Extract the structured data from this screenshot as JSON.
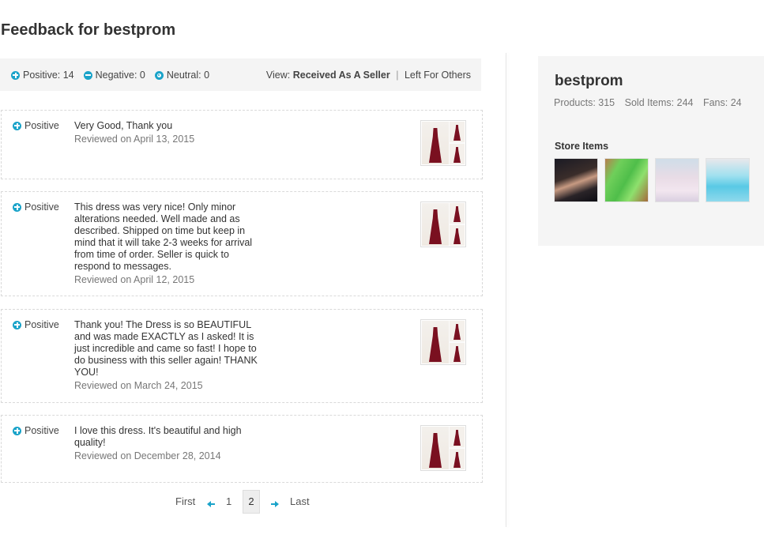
{
  "page": {
    "title": "Feedback for bestprom"
  },
  "summary": {
    "positive_label": "Positive: 14",
    "negative_label": "Negative: 0",
    "neutral_label": "Neutral: 0",
    "view_prefix": "View:",
    "view_selected": "Received As A Seller",
    "view_other": "Left For Others",
    "separator": "|"
  },
  "reviews": [
    {
      "rating": "Positive",
      "text": "Very Good, Thank you",
      "date": "Reviewed on April 13, 2015"
    },
    {
      "rating": "Positive",
      "text": "This dress was very nice! Only minor alterations needed. Well made and as described. Shipped on time but keep in mind that it will take 2-3 weeks for arrival from time of order. Seller is quick to respond to messages.",
      "date": "Reviewed on April 12, 2015"
    },
    {
      "rating": "Positive",
      "text": "Thank you! The Dress is so BEAUTIFUL and was made EXACTLY as I asked! It is just incredible and came so fast! I hope to do business with this seller again! THANK YOU!",
      "date": "Reviewed on March 24, 2015"
    },
    {
      "rating": "Positive",
      "text": "I love this dress. It's beautiful and high quality!",
      "date": "Reviewed on December 28, 2014"
    }
  ],
  "pagination": {
    "first": "First",
    "page1": "1",
    "page2": "2",
    "last": "Last",
    "current": 2
  },
  "store": {
    "name": "bestprom",
    "products": "Products: 315",
    "sold_items": "Sold Items: 244",
    "fans": "Fans: 24",
    "items_label": "Store Items"
  },
  "colors": {
    "accent": "#1aa3c9",
    "summary_bg": "#f4f4f4",
    "side_bg": "#f5f5f5",
    "dress": "#7a1020"
  }
}
